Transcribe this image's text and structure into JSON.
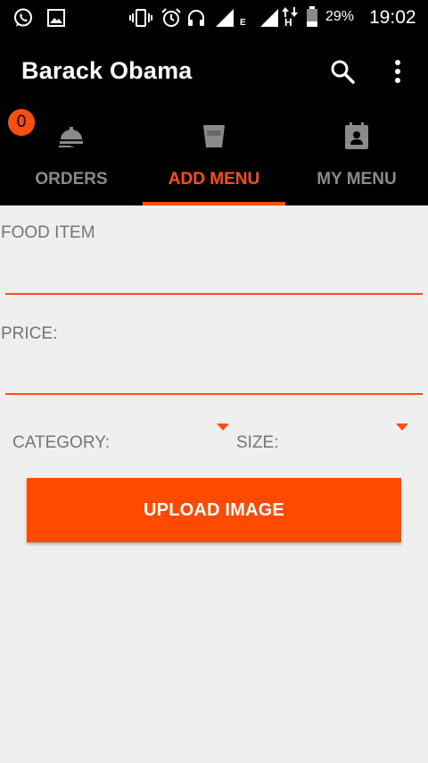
{
  "status_bar": {
    "icons": [
      "whatsapp-icon",
      "image-icon",
      "vibrate-icon",
      "alarm-icon",
      "headset-icon",
      "signal-icon",
      "wifi-signal-icon",
      "data-arrows-icon",
      "battery-icon"
    ],
    "network_type": "E",
    "data_letter": "H",
    "battery_percent": "29%",
    "time": "19:02"
  },
  "app_bar": {
    "title": "Barack Obama",
    "actions": [
      "search-icon",
      "more-vert-icon"
    ]
  },
  "tabs": {
    "badge_count": "0",
    "items": [
      {
        "label": "ORDERS",
        "icon": "room-service-icon",
        "active": false
      },
      {
        "label": "ADD MENU",
        "icon": "cup-icon",
        "active": true
      },
      {
        "label": "MY MENU",
        "icon": "menu-list-icon",
        "active": false
      }
    ],
    "accent_color": "#ff4e0f"
  },
  "form": {
    "food_item_label": "FOOD ITEM",
    "food_item_value": "",
    "price_label": "PRICE:",
    "price_value": "",
    "category_label": "CATEGORY:",
    "size_label": "SIZE:",
    "upload_button_label": "UPLOAD IMAGE"
  }
}
